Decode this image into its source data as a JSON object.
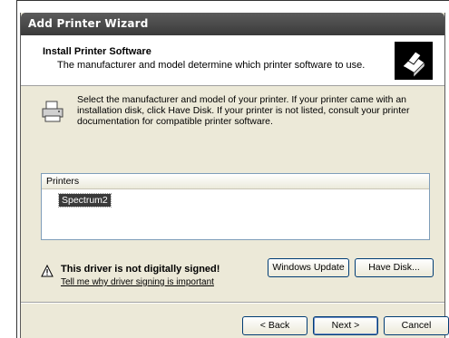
{
  "window": {
    "title": "Add Printer Wizard"
  },
  "header": {
    "title": "Install Printer Software",
    "subtitle": "The manufacturer and model determine which printer software to use.",
    "icon": "printer-install-icon"
  },
  "intro": {
    "icon": "printer-icon",
    "text": "Select the manufacturer and model of your printer. If your printer came with an installation disk, click Have Disk. If your printer is not listed, consult your printer documentation for compatible printer software."
  },
  "printers_list": {
    "header": "Printers",
    "items": [
      "Spectrum2"
    ],
    "selected_index": 0
  },
  "warning": {
    "icon": "warning-icon",
    "title": "This driver is not digitally signed!",
    "link": "Tell me why driver signing is important"
  },
  "buttons": {
    "windows_update": "Windows Update",
    "have_disk": "Have Disk...",
    "back": "< Back",
    "next": "Next >",
    "cancel": "Cancel"
  }
}
